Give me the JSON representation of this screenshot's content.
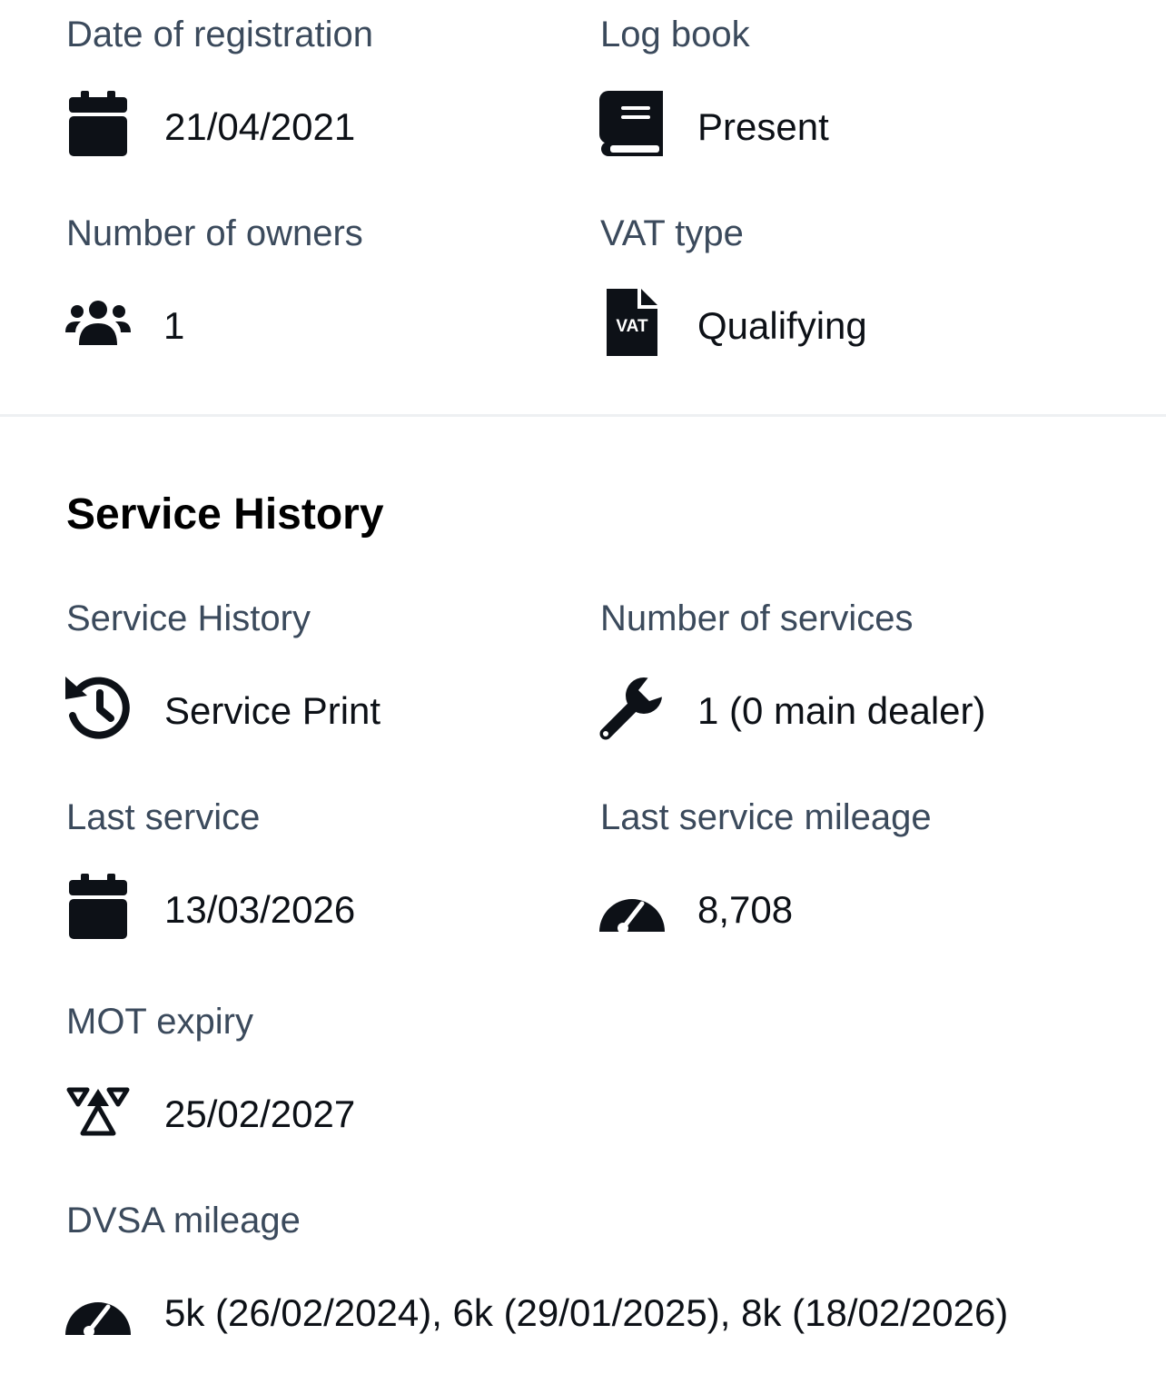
{
  "vehicle_details": {
    "date_of_registration": {
      "label": "Date of registration",
      "value": "21/04/2021",
      "icon": "calendar-icon"
    },
    "log_book": {
      "label": "Log book",
      "value": "Present",
      "icon": "book-icon"
    },
    "number_of_owners": {
      "label": "Number of owners",
      "value": "1",
      "icon": "users-icon"
    },
    "vat_type": {
      "label": "VAT type",
      "value": "Qualifying",
      "icon": "vat-file-icon",
      "icon_text": "VAT"
    }
  },
  "service_history": {
    "title": "Service History",
    "service_history": {
      "label": "Service History",
      "value": "Service Print",
      "icon": "history-icon"
    },
    "number_of_services": {
      "label": "Number of services",
      "value": "1 (0 main dealer)",
      "icon": "wrench-icon"
    },
    "last_service": {
      "label": "Last service",
      "value": "13/03/2026",
      "icon": "calendar-icon"
    },
    "last_service_mileage": {
      "label": "Last service mileage",
      "value": "8,708",
      "icon": "gauge-icon"
    },
    "mot_expiry": {
      "label": "MOT expiry",
      "value": "25/02/2027",
      "icon": "mot-triangles-icon"
    },
    "dvsa_mileage": {
      "label": "DVSA mileage",
      "value": "5k (26/02/2024), 6k (29/01/2025), 8k (18/02/2026)",
      "icon": "gauge-icon"
    }
  },
  "colors": {
    "label": "#3b4a5c",
    "value": "#0d1117",
    "icon": "#0d1117",
    "divider": "#eef0f2"
  }
}
